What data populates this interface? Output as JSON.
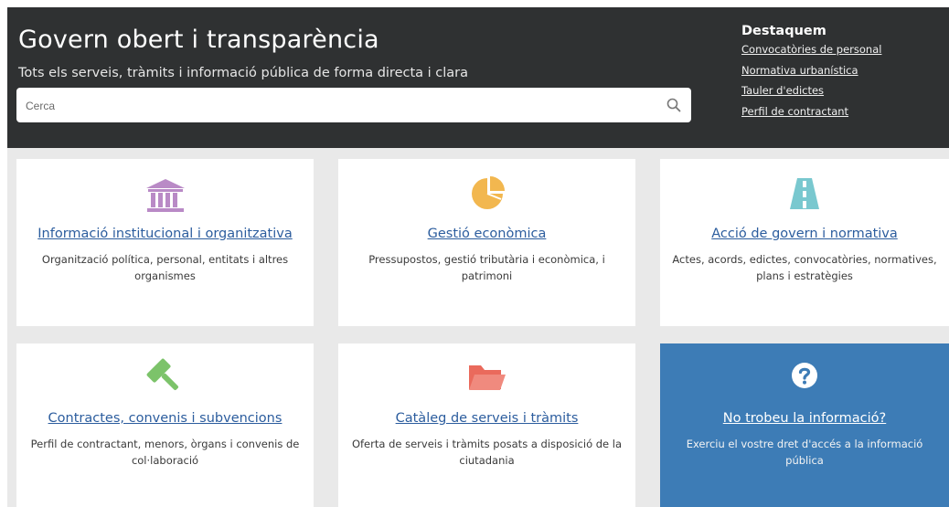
{
  "header": {
    "title": "Govern obert i transparència",
    "subtitle": "Tots els serveis, tràmits i informació pública de forma directa i clara",
    "search": {
      "placeholder": "Cerca",
      "icon": "search-icon"
    }
  },
  "highlights": {
    "heading": "Destaquem",
    "links": [
      "Convocatòries de personal",
      "Normativa urbanística",
      "Tauler d'edictes",
      "Perfil de contractant"
    ]
  },
  "cards": [
    {
      "title": "Informació institucional i organitzativa",
      "desc": "Organització política, personal, entitats i altres organismes",
      "icon": "institution-icon",
      "color": "#b98ac6"
    },
    {
      "title": "Gestió econòmica",
      "desc": "Pressupostos, gestió tributària i econòmica, i patrimoni",
      "icon": "pie-chart-icon",
      "color": "#f2b74f"
    },
    {
      "title": "Acció de govern i normativa",
      "desc": "Actes, acords, edictes, convocatòries, normatives, plans i estratègies",
      "icon": "road-icon",
      "color": "#79c8cf"
    },
    {
      "title": "Contractes, convenis i subvencions",
      "desc": "Perfil de contractant, menors, òrgans i convenis de col·laboració",
      "icon": "gavel-icon",
      "color": "#7cc36a"
    },
    {
      "title": "Catàleg de serveis i tràmits",
      "desc": "Oferta de serveis i tràmits posats a disposició de la ciutadania",
      "icon": "folder-open-icon",
      "color": "#ea6a5c"
    },
    {
      "title": "No trobeu la informació?",
      "desc": "Exerciu el vostre dret d'accés a la informació pública",
      "icon": "question-circle-icon",
      "color": "#ffffff",
      "background": "#3d7cb6"
    }
  ]
}
